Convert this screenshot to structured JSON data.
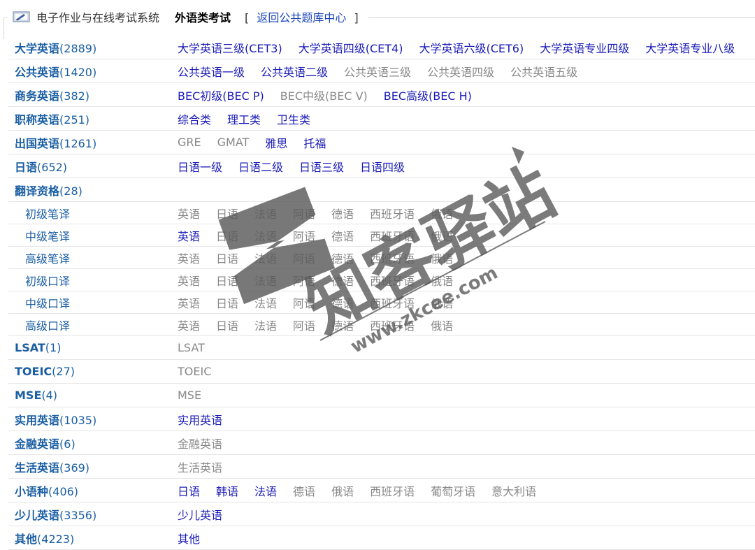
{
  "header": {
    "system_title": "电子作业与在线考试系统",
    "category_title": "外语类考试",
    "back_open": "[",
    "back_label": "返回公共题库中心",
    "back_close": "]"
  },
  "watermark": {
    "brand": "知客驿站",
    "url": "www.zkcee.com",
    "color": "#5a5a5a"
  },
  "categories": [
    {
      "name": "大学英语",
      "count": "(2889)",
      "bold": true,
      "sub": false,
      "items": [
        {
          "label": "大学英语三级(CET3)",
          "on": true
        },
        {
          "label": "大学英语四级(CET4)",
          "on": true
        },
        {
          "label": "大学英语六级(CET6)",
          "on": true
        },
        {
          "label": "大学英语专业四级",
          "on": true
        },
        {
          "label": "大学英语专业八级",
          "on": true
        }
      ]
    },
    {
      "name": "公共英语",
      "count": "(1420)",
      "bold": true,
      "sub": false,
      "items": [
        {
          "label": "公共英语一级",
          "on": true
        },
        {
          "label": "公共英语二级",
          "on": true
        },
        {
          "label": "公共英语三级",
          "on": false
        },
        {
          "label": "公共英语四级",
          "on": false
        },
        {
          "label": "公共英语五级",
          "on": false
        }
      ]
    },
    {
      "name": "商务英语",
      "count": "(382)",
      "bold": true,
      "sub": false,
      "items": [
        {
          "label": "BEC初级(BEC P)",
          "on": true
        },
        {
          "label": "BEC中级(BEC V)",
          "on": false
        },
        {
          "label": "BEC高级(BEC H)",
          "on": true
        }
      ]
    },
    {
      "name": "职称英语",
      "count": "(251)",
      "bold": true,
      "sub": false,
      "items": [
        {
          "label": "综合类",
          "on": true
        },
        {
          "label": "理工类",
          "on": true
        },
        {
          "label": "卫生类",
          "on": true
        }
      ]
    },
    {
      "name": "出国英语",
      "count": "(1261)",
      "bold": true,
      "sub": false,
      "items": [
        {
          "label": "GRE",
          "on": false
        },
        {
          "label": "GMAT",
          "on": false
        },
        {
          "label": "雅思",
          "on": true
        },
        {
          "label": "托福",
          "on": true
        }
      ]
    },
    {
      "name": "日语",
      "count": "(652)",
      "bold": true,
      "sub": false,
      "items": [
        {
          "label": "日语一级",
          "on": true
        },
        {
          "label": "日语二级",
          "on": true
        },
        {
          "label": "日语三级",
          "on": true
        },
        {
          "label": "日语四级",
          "on": true
        }
      ]
    },
    {
      "name": "翻译资格",
      "count": "(28)",
      "bold": true,
      "sub": false,
      "items": []
    },
    {
      "name": "初级笔译",
      "count": "",
      "bold": false,
      "sub": true,
      "items": [
        {
          "label": "英语",
          "on": false
        },
        {
          "label": "日语",
          "on": false
        },
        {
          "label": "法语",
          "on": false
        },
        {
          "label": "阿语",
          "on": false
        },
        {
          "label": "德语",
          "on": false
        },
        {
          "label": "西班牙语",
          "on": false
        },
        {
          "label": "俄语",
          "on": false
        }
      ]
    },
    {
      "name": "中级笔译",
      "count": "",
      "bold": false,
      "sub": true,
      "items": [
        {
          "label": "英语",
          "on": true
        },
        {
          "label": "日语",
          "on": false
        },
        {
          "label": "法语",
          "on": false
        },
        {
          "label": "阿语",
          "on": false
        },
        {
          "label": "德语",
          "on": false
        },
        {
          "label": "西班牙语",
          "on": false
        },
        {
          "label": "俄语",
          "on": false
        }
      ]
    },
    {
      "name": "高级笔译",
      "count": "",
      "bold": false,
      "sub": true,
      "items": [
        {
          "label": "英语",
          "on": false
        },
        {
          "label": "日语",
          "on": false
        },
        {
          "label": "法语",
          "on": false
        },
        {
          "label": "阿语",
          "on": false
        },
        {
          "label": "德语",
          "on": false
        },
        {
          "label": "西班牙语",
          "on": false
        },
        {
          "label": "俄语",
          "on": false
        }
      ]
    },
    {
      "name": "初级口译",
      "count": "",
      "bold": false,
      "sub": true,
      "items": [
        {
          "label": "英语",
          "on": false
        },
        {
          "label": "日语",
          "on": false
        },
        {
          "label": "法语",
          "on": false
        },
        {
          "label": "阿语",
          "on": false
        },
        {
          "label": "德语",
          "on": false
        },
        {
          "label": "西班牙语",
          "on": false
        },
        {
          "label": "俄语",
          "on": false
        }
      ]
    },
    {
      "name": "中级口译",
      "count": "",
      "bold": false,
      "sub": true,
      "items": [
        {
          "label": "英语",
          "on": false
        },
        {
          "label": "日语",
          "on": false
        },
        {
          "label": "法语",
          "on": false
        },
        {
          "label": "阿语",
          "on": false
        },
        {
          "label": "德语",
          "on": false
        },
        {
          "label": "西班牙语",
          "on": false
        },
        {
          "label": "俄语",
          "on": false
        }
      ]
    },
    {
      "name": "高级口译",
      "count": "",
      "bold": false,
      "sub": true,
      "items": [
        {
          "label": "英语",
          "on": false
        },
        {
          "label": "日语",
          "on": false
        },
        {
          "label": "法语",
          "on": false
        },
        {
          "label": "阿语",
          "on": false
        },
        {
          "label": "德语",
          "on": false
        },
        {
          "label": "西班牙语",
          "on": false
        },
        {
          "label": "俄语",
          "on": false
        }
      ]
    },
    {
      "name": "LSAT",
      "count": "(1)",
      "bold": true,
      "sub": false,
      "items": [
        {
          "label": "LSAT",
          "on": false
        }
      ]
    },
    {
      "name": "TOEIC",
      "count": "(27)",
      "bold": true,
      "sub": false,
      "items": [
        {
          "label": "TOEIC",
          "on": false
        }
      ]
    },
    {
      "name": "MSE",
      "count": "(4)",
      "bold": true,
      "sub": false,
      "items": [
        {
          "label": "MSE",
          "on": false
        }
      ]
    },
    {
      "name": "实用英语",
      "count": "(1035)",
      "bold": true,
      "sub": false,
      "items": [
        {
          "label": "实用英语",
          "on": true
        }
      ]
    },
    {
      "name": "金融英语",
      "count": "(6)",
      "bold": true,
      "sub": false,
      "items": [
        {
          "label": "金融英语",
          "on": false
        }
      ]
    },
    {
      "name": "生活英语",
      "count": "(369)",
      "bold": true,
      "sub": false,
      "items": [
        {
          "label": "生活英语",
          "on": false
        }
      ]
    },
    {
      "name": "小语种",
      "count": "(406)",
      "bold": true,
      "sub": false,
      "items": [
        {
          "label": "日语",
          "on": true
        },
        {
          "label": "韩语",
          "on": true
        },
        {
          "label": "法语",
          "on": true
        },
        {
          "label": "德语",
          "on": false
        },
        {
          "label": "俄语",
          "on": false
        },
        {
          "label": "西班牙语",
          "on": false
        },
        {
          "label": "葡萄牙语",
          "on": false
        },
        {
          "label": "意大利语",
          "on": false
        }
      ]
    },
    {
      "name": "少儿英语",
      "count": "(3356)",
      "bold": true,
      "sub": false,
      "items": [
        {
          "label": "少儿英语",
          "on": true
        }
      ]
    },
    {
      "name": "其他",
      "count": "(4223)",
      "bold": true,
      "sub": false,
      "items": [
        {
          "label": "其他",
          "on": true
        }
      ]
    }
  ]
}
